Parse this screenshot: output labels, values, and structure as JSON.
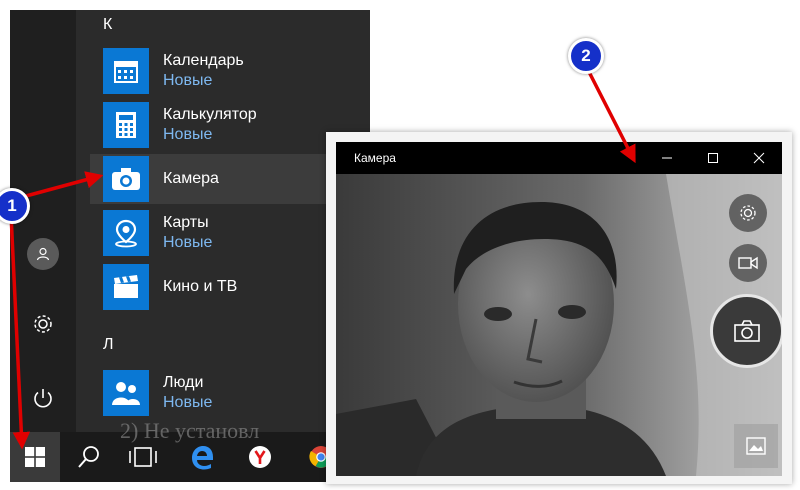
{
  "start_menu": {
    "groups": [
      {
        "letter": "К"
      },
      {
        "letter": "Л"
      }
    ],
    "apps": [
      {
        "name": "Календарь",
        "sub": "Новые",
        "icon": "calendar-icon"
      },
      {
        "name": "Калькулятор",
        "sub": "Новые",
        "icon": "calculator-icon"
      },
      {
        "name": "Камера",
        "sub": "",
        "icon": "camera-icon"
      },
      {
        "name": "Карты",
        "sub": "Новые",
        "icon": "maps-icon"
      },
      {
        "name": "Кино и ТВ",
        "sub": "",
        "icon": "movies-tv-icon"
      },
      {
        "name": "Люди",
        "sub": "Новые",
        "icon": "people-icon"
      }
    ],
    "rail": [
      "user-icon",
      "settings-icon",
      "power-icon"
    ]
  },
  "taskbar": {
    "items": [
      "windows-logo-icon",
      "search-icon",
      "task-view-icon",
      "edge-icon",
      "yandex-browser-icon",
      "chrome-icon"
    ],
    "peek_text": "2) Не установл"
  },
  "camera_window": {
    "title": "Камера",
    "controls": [
      "minimize-icon",
      "maximize-icon",
      "close-icon"
    ],
    "side_controls": [
      "settings-icon",
      "video-mode-icon",
      "take-photo-icon",
      "gallery-icon"
    ]
  },
  "annotations": {
    "badge_1": "1",
    "badge_2": "2",
    "arrow_color": "#e00000",
    "badge_color": "#1530c9"
  },
  "colors": {
    "tile_blue": "#0a78d4",
    "sub_text": "#7eb8f0",
    "menu_bg": "#2b2b2b"
  }
}
